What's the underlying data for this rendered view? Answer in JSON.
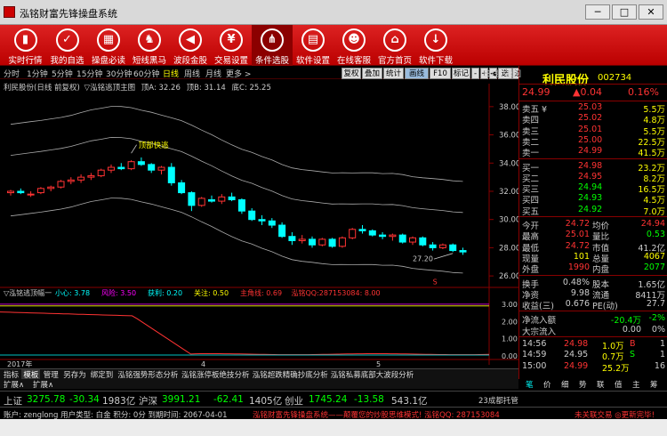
{
  "window": {
    "title": "泓铭财富先锋操盘系统",
    "min": "─",
    "max": "□",
    "close": "✕"
  },
  "toolbar": [
    {
      "label": "实时行情",
      "icon": "bar-chart-icon",
      "glyph": "▮"
    },
    {
      "label": "我的自选",
      "icon": "star-icon",
      "glyph": "✓"
    },
    {
      "label": "操盘必读",
      "icon": "book-icon",
      "glyph": "▦"
    },
    {
      "label": "短线黑马",
      "icon": "horse-icon",
      "glyph": "♞"
    },
    {
      "label": "波段金股",
      "icon": "speaker-icon",
      "glyph": "◀"
    },
    {
      "label": "交易设置",
      "icon": "yen-icon",
      "glyph": "¥"
    },
    {
      "label": "条件选股",
      "icon": "tree-icon",
      "glyph": "⋔"
    },
    {
      "label": "软件设置",
      "icon": "clipboard-icon",
      "glyph": "▤"
    },
    {
      "label": "在线客服",
      "icon": "people-icon",
      "glyph": "☻"
    },
    {
      "label": "官方首页",
      "icon": "home-icon",
      "glyph": "⌂"
    },
    {
      "label": "软件下载",
      "icon": "download-icon",
      "glyph": "↓"
    }
  ],
  "periods": [
    "分时",
    "1分钟",
    "5分钟",
    "15分钟",
    "30分钟",
    "60分钟",
    "日线",
    "周线",
    "月线",
    "更多 >"
  ],
  "active_period": "日线",
  "chart_buttons": [
    "复权",
    "叠加",
    "统计",
    "画线",
    "F10",
    "标记",
    "-",
    "+",
    "◀",
    "选股",
    "返回"
  ],
  "chart_info": {
    "stock_label": "利民股份(日线 前复权)",
    "indicator": "▽泓铭逃顶主图",
    "top_label": "顶A: 32.26",
    "mid_label": "顶B: 31.14",
    "low_label": "底C: 25.25"
  },
  "chart_data": {
    "type": "candlestick",
    "y_ticks": [
      "38.00",
      "36.00",
      "34.00",
      "32.00",
      "30.00",
      "28.00",
      "26.00"
    ],
    "ylim": [
      25.25,
      39.0
    ],
    "signal_label": "顶部快逃",
    "price_label": "27.20",
    "marker_letter": "S",
    "date_label": "2017年",
    "date_ticks": [
      "4",
      "5"
    ],
    "candles": [
      [
        31.9,
        32.1,
        31.7,
        32.0
      ],
      [
        32.0,
        32.2,
        31.8,
        31.9
      ],
      [
        31.8,
        32.0,
        31.6,
        31.8
      ],
      [
        31.9,
        32.3,
        31.8,
        32.2
      ],
      [
        32.2,
        32.4,
        32.0,
        32.3
      ],
      [
        32.3,
        32.8,
        32.2,
        32.7
      ],
      [
        32.7,
        33.0,
        32.5,
        32.8
      ],
      [
        32.8,
        33.2,
        32.6,
        33.0
      ],
      [
        33.0,
        33.3,
        32.8,
        33.1
      ],
      [
        33.1,
        33.6,
        33.0,
        33.5
      ],
      [
        33.5,
        33.9,
        33.3,
        33.7
      ],
      [
        33.7,
        34.0,
        33.5,
        33.6
      ],
      [
        33.6,
        34.2,
        33.5,
        34.1
      ],
      [
        34.1,
        34.4,
        33.8,
        33.9
      ],
      [
        33.9,
        34.0,
        33.3,
        33.5
      ],
      [
        33.5,
        33.8,
        33.2,
        33.7
      ],
      [
        33.7,
        34.0,
        32.4,
        32.6
      ],
      [
        32.6,
        32.8,
        31.8,
        31.9
      ],
      [
        31.9,
        32.0,
        30.6,
        31.0
      ],
      [
        31.0,
        31.6,
        30.9,
        31.5
      ],
      [
        31.4,
        31.7,
        31.2,
        31.3
      ],
      [
        31.3,
        31.8,
        31.1,
        31.6
      ],
      [
        31.6,
        31.9,
        31.3,
        31.4
      ],
      [
        31.4,
        31.5,
        30.4,
        30.6
      ],
      [
        30.6,
        30.8,
        29.9,
        30.0
      ],
      [
        30.0,
        30.3,
        29.6,
        29.9
      ],
      [
        29.9,
        30.1,
        29.4,
        29.6
      ],
      [
        29.6,
        29.8,
        28.7,
        28.8
      ],
      [
        28.8,
        29.1,
        28.2,
        28.5
      ],
      [
        28.5,
        28.9,
        28.3,
        28.6
      ],
      [
        28.6,
        28.8,
        28.0,
        28.2
      ],
      [
        28.2,
        28.7,
        28.1,
        28.6
      ],
      [
        28.6,
        28.7,
        28.0,
        28.1
      ],
      [
        28.1,
        28.8,
        28.0,
        28.7
      ],
      [
        28.7,
        29.4,
        28.6,
        29.3
      ],
      [
        29.3,
        29.6,
        29.0,
        29.2
      ],
      [
        29.2,
        29.3,
        28.8,
        28.9
      ],
      [
        28.9,
        29.1,
        28.6,
        28.8
      ],
      [
        28.8,
        29.0,
        28.5,
        28.9
      ],
      [
        28.9,
        29.0,
        28.3,
        28.4
      ],
      [
        28.4,
        28.8,
        28.2,
        28.7
      ],
      [
        28.7,
        28.8,
        28.1,
        28.2
      ],
      [
        28.2,
        28.4,
        27.8,
        28.0
      ],
      [
        28.0,
        28.3,
        27.9,
        28.2
      ],
      [
        28.2,
        28.3,
        27.7,
        27.8
      ],
      [
        27.8,
        28.0,
        27.5,
        27.7
      ]
    ]
  },
  "sub_chart": {
    "label": "▽泓铭逃顶幅一",
    "legend": [
      {
        "text": "小心: 3.78",
        "color": "#0ff"
      },
      {
        "text": "风险: 3.50",
        "color": "#f0f"
      },
      {
        "text": "获利: 0.20",
        "color": "#0ff"
      },
      {
        "text": "关注: 0.50",
        "color": "#ff0"
      },
      {
        "text": "主角线: 0.69",
        "color": "#f33"
      },
      {
        "text": "泓铭QQ:287153084: 8.00",
        "color": "#f33"
      }
    ],
    "y_ticks": [
      "3.00",
      "2.00",
      "1.00",
      "0.00"
    ]
  },
  "panel": {
    "top_tabs": [
      "日线",
      "返回"
    ],
    "name": "利民股份",
    "code": "002734",
    "price": "24.99",
    "change": "▲0.04",
    "change_pct": "0.16%",
    "asks": [
      {
        "label": "卖五 ¥",
        "price": "25.03",
        "vol": "5.5万"
      },
      {
        "label": "卖四",
        "price": "25.02",
        "vol": "4.8万"
      },
      {
        "label": "卖三",
        "price": "25.01",
        "vol": "5.5万"
      },
      {
        "label": "卖二",
        "price": "25.00",
        "vol": "22.5万"
      },
      {
        "label": "卖一",
        "price": "24.99",
        "vol": "41.5万"
      }
    ],
    "bids": [
      {
        "label": "买一",
        "price": "24.98",
        "vol": "23.2万"
      },
      {
        "label": "买二",
        "price": "24.95",
        "vol": "8.2万"
      },
      {
        "label": "买三",
        "price": "24.94",
        "vol": "16.5万"
      },
      {
        "label": "买四",
        "price": "24.93",
        "vol": "4.5万"
      },
      {
        "label": "买五",
        "price": "24.92",
        "vol": "7.0万"
      }
    ],
    "stats": [
      {
        "l1": "今开",
        "v1": "24.72",
        "c1": "#f33",
        "l2": "均价",
        "v2": "24.94",
        "c2": "#f33"
      },
      {
        "l1": "最高",
        "v1": "25.01",
        "c1": "#f33",
        "l2": "量比",
        "v2": "0.53",
        "c2": "#0f0"
      },
      {
        "l1": "最低",
        "v1": "24.72",
        "c1": "#f33",
        "l2": "市值",
        "v2": "41.2亿",
        "c2": "#ccc"
      },
      {
        "l1": "现量",
        "v1": "101",
        "c1": "#ff0",
        "l2": "总量",
        "v2": "4067",
        "c2": "#ff0"
      },
      {
        "l1": "外盘",
        "v1": "1990",
        "c1": "#f33",
        "l2": "内盘",
        "v2": "2077",
        "c2": "#0f0"
      }
    ],
    "fund": [
      {
        "l1": "换手",
        "v1": "0.48%",
        "l2": "股本",
        "v2": "1.65亿"
      },
      {
        "l1": "净资",
        "v1": "9.98",
        "l2": "流通",
        "v2": "8411万"
      },
      {
        "l1": "收益(三)",
        "v1": "0.676",
        "l2": "PE(动)",
        "v2": "27.7"
      }
    ],
    "flow": [
      {
        "label": "净流入额",
        "v1": "-20.4万",
        "v2": "-2%"
      },
      {
        "label": "大宗流入",
        "v1": "0.00",
        "v2": "0%"
      }
    ],
    "ticks": [
      {
        "time": "14:56",
        "price": "24.98",
        "vol": "1.0万",
        "flag": "B",
        "n": "1"
      },
      {
        "time": "14:59",
        "price": "24.95",
        "vol": "0.7万",
        "flag": "S",
        "n": "1"
      },
      {
        "time": "15:00",
        "price": "24.99",
        "vol": "25.2万",
        "flag": "",
        "n": "16"
      }
    ],
    "bottom_tabs": [
      "笔",
      "价",
      "细",
      "势",
      "联",
      "值",
      "主",
      "筹"
    ]
  },
  "bottom_tabs": [
    "指标",
    "模板",
    "管理",
    "另存为",
    "绑定到",
    "泓铭强势形态分析",
    "泓铭涨停板绝技分析",
    "泓铭超跌精确抄底分析",
    "泓铭私募底部大波段分析"
  ],
  "bottom_tabs2": [
    "扩展∧",
    "扩展∧"
  ],
  "index_bar": [
    {
      "text": "上证",
      "color": "#ccc"
    },
    {
      "text": "3275.78",
      "color": "#0f0"
    },
    {
      "text": "-30.34",
      "color": "#0f0"
    },
    {
      "text": "1983亿",
      "color": "#ccc"
    },
    {
      "text": "沪深",
      "color": "#ccc"
    },
    {
      "text": "3991.21",
      "color": "#0f0"
    },
    {
      "text": "-62.41",
      "color": "#0f0"
    },
    {
      "text": "1405亿",
      "color": "#ccc"
    },
    {
      "text": "创业",
      "color": "#ccc"
    },
    {
      "text": "1745.24",
      "color": "#0f0"
    },
    {
      "text": "-13.58",
      "color": "#0f0"
    },
    {
      "text": "543.1亿",
      "color": "#ccc"
    },
    {
      "text": "23成都托管",
      "color": "#ccc"
    }
  ],
  "status": {
    "account": "账户: zenglong 用户类型: 白金 积分: 0分 到期时间: 2067-04-01",
    "marquee": "泓铭财富先锋操盘系统——颠覆您的炒股思维模式! 泓铭QQ: 287153084",
    "right": "未关联交易 ◎更新完毕!"
  }
}
